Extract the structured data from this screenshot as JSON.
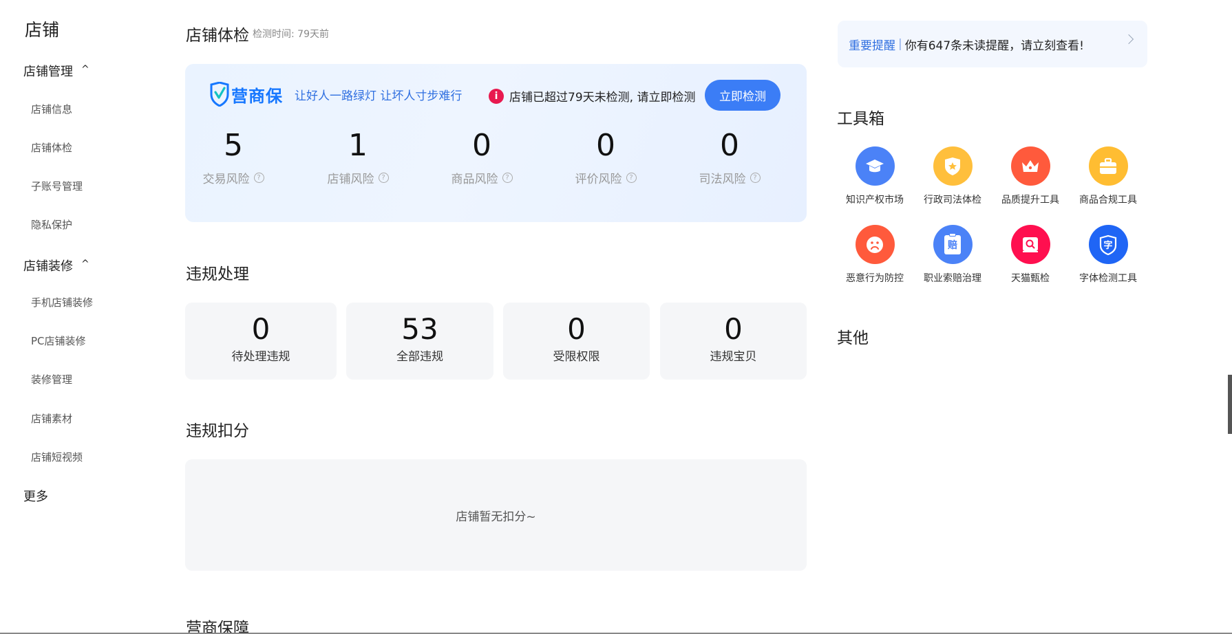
{
  "sidebar": {
    "title": "店铺",
    "groups": [
      {
        "label": "店铺管理",
        "caret": "^",
        "items": [
          "店铺信息",
          "店铺体检",
          "子账号管理",
          "隐私保护"
        ]
      },
      {
        "label": "店铺装修",
        "caret": "^",
        "items": [
          "手机店铺装修",
          "PC店铺装修",
          "装修管理",
          "店铺素材",
          "店铺短视频"
        ]
      }
    ],
    "more": "更多"
  },
  "health": {
    "title": "店铺体检",
    "subtitle": "检测时间: 79天前",
    "logo_text": "营商保",
    "slogan": "让好人一路绿灯 让坏人寸步难行",
    "warning_icon": "i",
    "warning": "店铺已超过79天未检测, 请立即检测",
    "check_button": "立即检测",
    "risks": [
      {
        "value": "5",
        "label": "交易风险"
      },
      {
        "value": "1",
        "label": "店铺风险"
      },
      {
        "value": "0",
        "label": "商品风险"
      },
      {
        "value": "0",
        "label": "评价风险"
      },
      {
        "value": "0",
        "label": "司法风险"
      }
    ],
    "help_glyph": "?"
  },
  "violation": {
    "title": "违规处理",
    "boxes": [
      {
        "value": "0",
        "label": "待处理违规"
      },
      {
        "value": "53",
        "label": "全部违规"
      },
      {
        "value": "0",
        "label": "受限权限"
      },
      {
        "value": "0",
        "label": "违规宝贝"
      }
    ]
  },
  "deduction": {
    "title": "违规扣分",
    "empty": "店铺暂无扣分~"
  },
  "guarantee": {
    "title": "营商保障"
  },
  "notice": {
    "tag": "重要提醒",
    "separator": "|",
    "text": "你有647条未读提醒，请立刻查看!"
  },
  "toolbox": {
    "title": "工具箱",
    "tools": [
      {
        "label": "知识产权市场",
        "icon": "graduation-cap-icon",
        "color": "#4b82f7"
      },
      {
        "label": "行政司法体检",
        "icon": "badge-star-icon",
        "color": "#ffbf3c"
      },
      {
        "label": "品质提升工具",
        "icon": "crown-icon",
        "color": "#ff5a3c"
      },
      {
        "label": "商品合规工具",
        "icon": "briefcase-icon",
        "color": "#ffbd32"
      },
      {
        "label": "恶意行为防控",
        "icon": "sad-face-icon",
        "color": "#ff5a3c"
      },
      {
        "label": "职业索赔治理",
        "icon": "clipboard-icon",
        "color": "#4b82f7",
        "glyph": "赔"
      },
      {
        "label": "天猫甄检",
        "icon": "search-shop-icon",
        "color": "#ff0f4f"
      },
      {
        "label": "字体检测工具",
        "icon": "shield-font-icon",
        "color": "#1f65f5",
        "glyph": "字"
      }
    ]
  },
  "other": {
    "title": "其他"
  }
}
